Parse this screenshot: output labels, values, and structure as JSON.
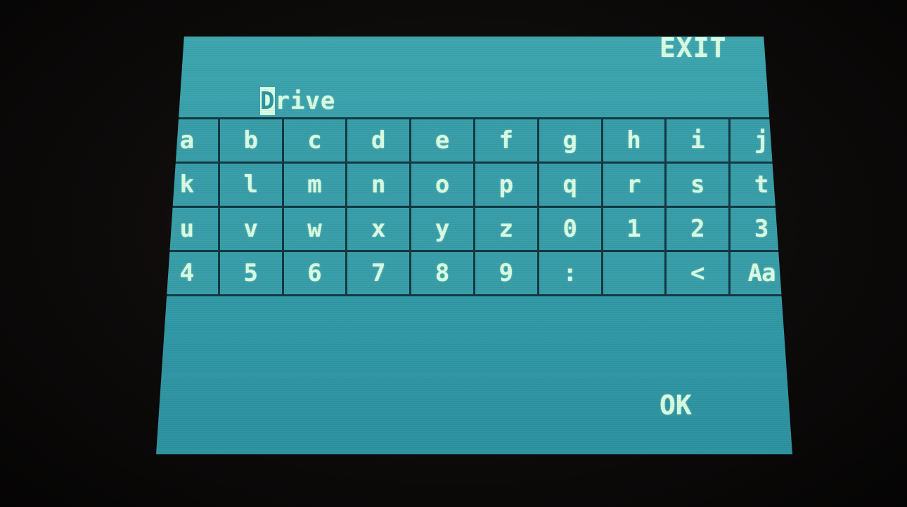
{
  "header": {
    "exit_label": "EXIT"
  },
  "name_field": {
    "cursor_char": "D",
    "rest_text": "rive"
  },
  "keyboard": {
    "rows": [
      [
        "a",
        "b",
        "c",
        "d",
        "e",
        "f",
        "g",
        "h",
        "i",
        "j"
      ],
      [
        "k",
        "l",
        "m",
        "n",
        "o",
        "p",
        "q",
        "r",
        "s",
        "t"
      ],
      [
        "u",
        "v",
        "w",
        "x",
        "y",
        "z",
        "0",
        "1",
        "2",
        "3"
      ],
      [
        "4",
        "5",
        "6",
        "7",
        "8",
        "9",
        ":",
        " ",
        "<",
        "Aa"
      ]
    ]
  },
  "footer": {
    "ok_label": "OK"
  },
  "colors": {
    "screen_bg": "#39a0ab",
    "key_bg": "#3a9faa",
    "grid_lines": "#123a44",
    "text": "#d9ffe4"
  }
}
